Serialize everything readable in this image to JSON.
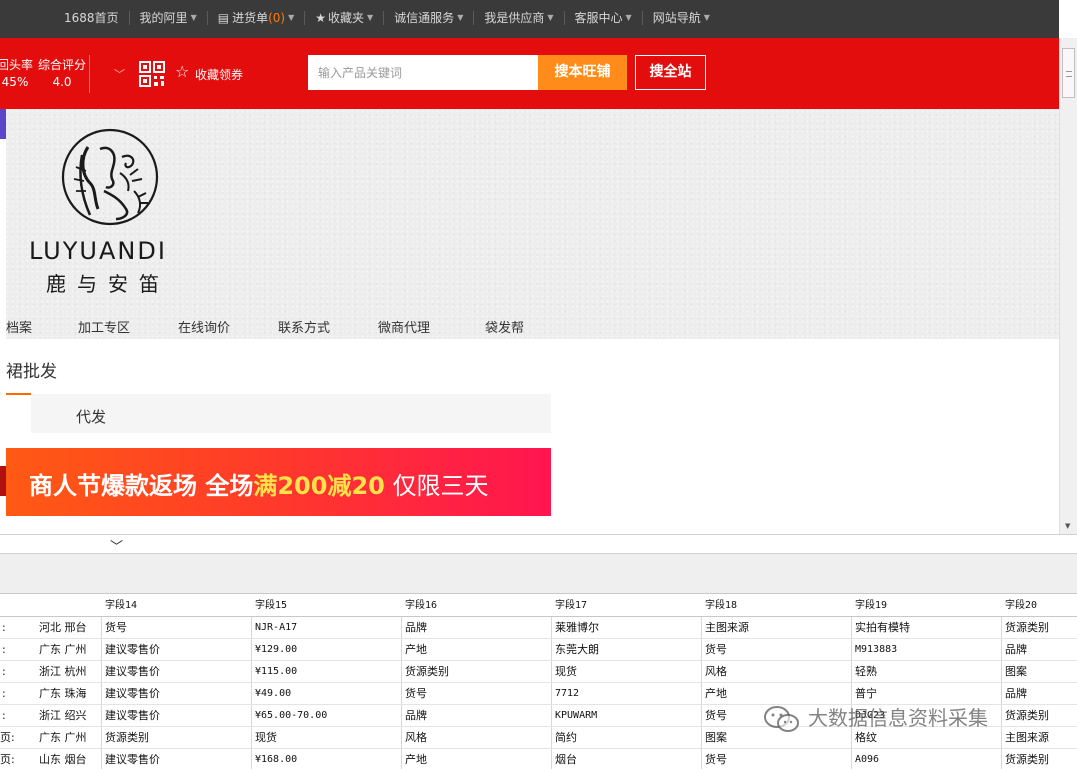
{
  "topbar": {
    "items": [
      "1688首页",
      "我的阿里",
      "进货单",
      "收藏夹",
      "诚信通服务",
      "我是供应商",
      "客服中心",
      "网站导航"
    ],
    "cart_count": "(0)"
  },
  "header": {
    "score1_label": "回头率",
    "score1_value": "45%",
    "score2_label": "综合评分",
    "score2_value": "4.0",
    "fav_label": "收藏领券",
    "search_placeholder": "输入产品关键词",
    "btn_store": "搜本旺铺",
    "btn_site": "搜全站"
  },
  "brand": {
    "name_en": "LUYUANDI",
    "name_cn": "鹿与安笛"
  },
  "banner_nav": [
    "档案",
    "加工专区",
    "在线询价",
    "联系方式",
    "微商代理",
    "袋发帮"
  ],
  "content": {
    "category_title": "裙批发",
    "subtab": "代发",
    "promo": {
      "part1": "商人节爆款返场 全场",
      "part2": "满200减20",
      "part3": " 仅限三天"
    }
  },
  "grid": {
    "headers": [
      "字段14",
      "字段15",
      "字段16",
      "字段17",
      "字段18",
      "字段19",
      "字段20"
    ],
    "rows": [
      [
        ":",
        "河北 邢台",
        "货号",
        "NJR-A17",
        "品牌",
        "莱雅博尔",
        "主图来源",
        "实拍有模特",
        "货源类别"
      ],
      [
        ":",
        "广东 广州",
        "建议零售价",
        "¥129.00",
        "产地",
        "东莞大朗",
        "货号",
        "M913883",
        "品牌"
      ],
      [
        ":",
        "浙江 杭州",
        "建议零售价",
        "¥115.00",
        "货源类别",
        "现货",
        "风格",
        "轻熟",
        "图案"
      ],
      [
        ":",
        "广东 珠海",
        "建议零售价",
        "¥49.00",
        "货号",
        "7712",
        "产地",
        "普宁",
        "品牌"
      ],
      [
        ":",
        "浙江 绍兴",
        "建议零售价",
        "¥65.00-70.00",
        "品牌",
        "KPUWARM",
        "货号",
        "DJG23",
        "货源类别"
      ],
      [
        "页:",
        "广东 广州",
        "货源类别",
        "现货",
        "风格",
        "简约",
        "图案",
        "格纹",
        "主图来源"
      ],
      [
        "页:",
        "山东 烟台",
        "建议零售价",
        "¥168.00",
        "产地",
        "烟台",
        "货号",
        "A096",
        "货源类别"
      ]
    ]
  },
  "watermark": "大数据信息资料采集",
  "colors": {
    "topbar": "#3a3a3a",
    "header_red": "#e30d0d",
    "search_btn": "#ff8c1a",
    "accent_orange": "#ff6a00"
  }
}
